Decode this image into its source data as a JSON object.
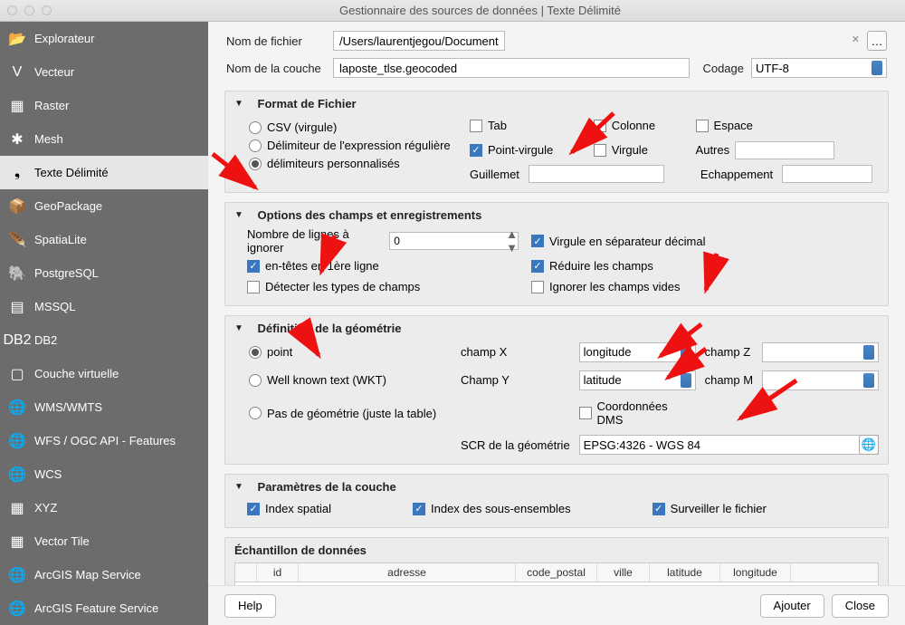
{
  "window": {
    "title": "Gestionnaire des sources de données | Texte Délimité"
  },
  "sidebar": {
    "items": [
      {
        "label": "Explorateur",
        "icon": "📂"
      },
      {
        "label": "Vecteur",
        "icon": "V"
      },
      {
        "label": "Raster",
        "icon": "▦"
      },
      {
        "label": "Mesh",
        "icon": "✱"
      },
      {
        "label": "Texte Délimité",
        "icon": "❟",
        "selected": true
      },
      {
        "label": "GeoPackage",
        "icon": "📦"
      },
      {
        "label": "SpatiaLite",
        "icon": "🪶"
      },
      {
        "label": "PostgreSQL",
        "icon": "🐘"
      },
      {
        "label": "MSSQL",
        "icon": "▤"
      },
      {
        "label": "DB2",
        "icon": "DB2"
      },
      {
        "label": "Couche virtuelle",
        "icon": "▢"
      },
      {
        "label": "WMS/WMTS",
        "icon": "🌐"
      },
      {
        "label": "WFS / OGC API - Features",
        "icon": "🌐"
      },
      {
        "label": "WCS",
        "icon": "🌐"
      },
      {
        "label": "XYZ",
        "icon": "▦"
      },
      {
        "label": "Vector Tile",
        "icon": "▦"
      },
      {
        "label": "ArcGIS Map Service",
        "icon": "🌐"
      },
      {
        "label": "ArcGIS Feature Service",
        "icon": "🌐"
      }
    ]
  },
  "filename": {
    "label": "Nom de fichier",
    "value": "/Users/laurentjegou/Documents/Cours/Urfist/grav/donnes_qgis/laposte_tlse.geocoded.csv"
  },
  "layername": {
    "label": "Nom de la couche",
    "value": "laposte_tlse.geocoded"
  },
  "encoding": {
    "label": "Codage",
    "value": "UTF-8"
  },
  "format": {
    "title": "Format de Fichier",
    "csv": "CSV (virgule)",
    "regex": "Délimiteur de l'expression régulière",
    "custom": "délimiteurs personnalisés",
    "selected": "custom",
    "delims": {
      "tab": "Tab",
      "colonne": "Colonne",
      "espace": "Espace",
      "semicolon": "Point-virgule",
      "virgule": "Virgule",
      "others": "Autres",
      "quote": "Guillemet",
      "escape": "Echappement"
    },
    "checked": {
      "semicolon": true
    }
  },
  "records": {
    "title": "Options des champs et enregistrements",
    "skip_label": "Nombre de lignes à ignorer",
    "skip_value": "0",
    "decimal": "Virgule en séparateur décimal",
    "header": "en-têtes en 1ère ligne",
    "trim": "Réduire les champs",
    "detect": "Détecter les types de champs",
    "ignore_empty": "Ignorer les champs vides",
    "checked": {
      "decimal": true,
      "header": true,
      "trim": true
    }
  },
  "geometry": {
    "title": "Définition de la géométrie",
    "point": "point",
    "wkt": "Well known text (WKT)",
    "none": "Pas de géométrie (juste la table)",
    "selected": "point",
    "x_label": "champ X",
    "x_val": "longitude",
    "y_label": "Champ Y",
    "y_val": "latitude",
    "z_label": "champ Z",
    "z_val": "",
    "m_label": "champ M",
    "m_val": "",
    "dms": "Coordonnées DMS",
    "crs_label": "SCR de la géométrie",
    "crs_val": "EPSG:4326 - WGS 84"
  },
  "layer_params": {
    "title": "Paramètres de la couche",
    "spatial": "Index spatial",
    "subset": "Index des sous-ensembles",
    "watch": "Surveiller le fichier"
  },
  "sample": {
    "title": "Échantillon de données",
    "columns": [
      "",
      "id",
      "adresse",
      "code_postal",
      "ville",
      "latitude",
      "longitude"
    ]
  },
  "buttons": {
    "help": "Help",
    "add": "Ajouter",
    "close": "Close",
    "browse": "…"
  }
}
